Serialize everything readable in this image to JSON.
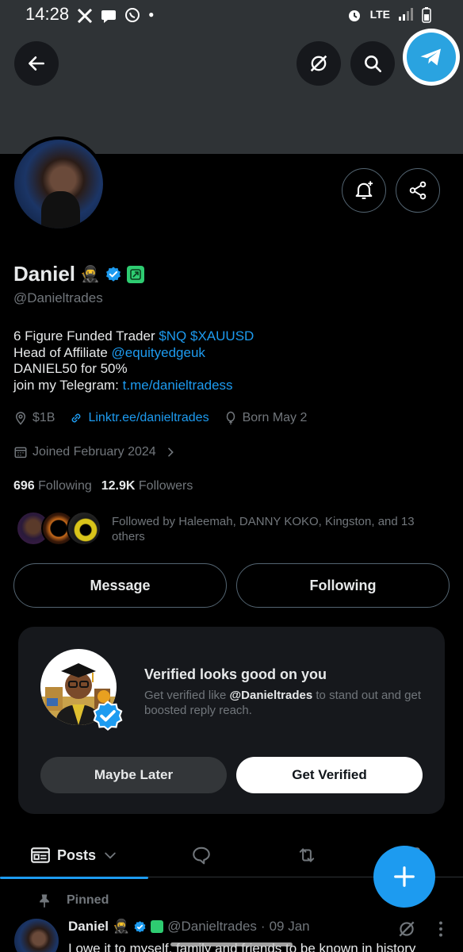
{
  "status_bar": {
    "time": "14:28",
    "network": "LTE"
  },
  "profile": {
    "name": "Daniel",
    "name_emoji": "🥷",
    "handle": "@Danieltrades",
    "bio": [
      {
        "text": "6 Figure Funded Trader ",
        "link": "$NQ $XAUUSD"
      },
      {
        "text": "Head of Affiliate ",
        "link": "@equityedgeuk"
      },
      {
        "text": "DANIEL50 for 50%",
        "link": ""
      },
      {
        "text": "join my Telegram: ",
        "link": "t.me/danieltradess"
      }
    ],
    "location": "$1B",
    "website": "Linktr.ee/danieltrades",
    "born": "Born May 2",
    "joined": "Joined February 2024",
    "following_count": "696",
    "following_label": "Following",
    "followers_count": "12.9K",
    "followers_label": "Followers",
    "followed_by": "Followed by Haleemah, DANNY KOKO, Kingston, and 13 others"
  },
  "actions": {
    "message": "Message",
    "following": "Following"
  },
  "verified_card": {
    "title": "Verified looks good on you",
    "text_prefix": "Get verified like ",
    "text_handle": "@Danieltrades",
    "text_suffix": " to stand out and get boosted reply reach.",
    "maybe_later": "Maybe Later",
    "get_verified": "Get Verified"
  },
  "tabs": {
    "posts": "Posts"
  },
  "pinned_post": {
    "pinned_label": "Pinned",
    "name": "Daniel",
    "name_emoji": "🥷",
    "handle": "@Danieltrades",
    "separator": "·",
    "date": "09 Jan",
    "text": "I owe it to myself, family and friends to be known in history"
  },
  "colors": {
    "accent": "#1d9bf0",
    "background": "#000000",
    "secondary_text": "#71767b",
    "banner": "#2f3336",
    "telegram": "#2aa3e0",
    "green_badge": "#2ecc71"
  },
  "icons": [
    "back-arrow-icon",
    "grok-icon",
    "search-icon",
    "telegram-icon",
    "notification-bell-add-icon",
    "share-icon",
    "verified-badge-icon",
    "affiliate-badge-icon",
    "location-icon",
    "link-icon",
    "balloon-icon",
    "calendar-icon",
    "chevron-right-icon",
    "posts-icon",
    "chevron-down-icon",
    "replies-icon",
    "repost-icon",
    "compose-plus-icon",
    "pin-icon",
    "more-icon"
  ]
}
